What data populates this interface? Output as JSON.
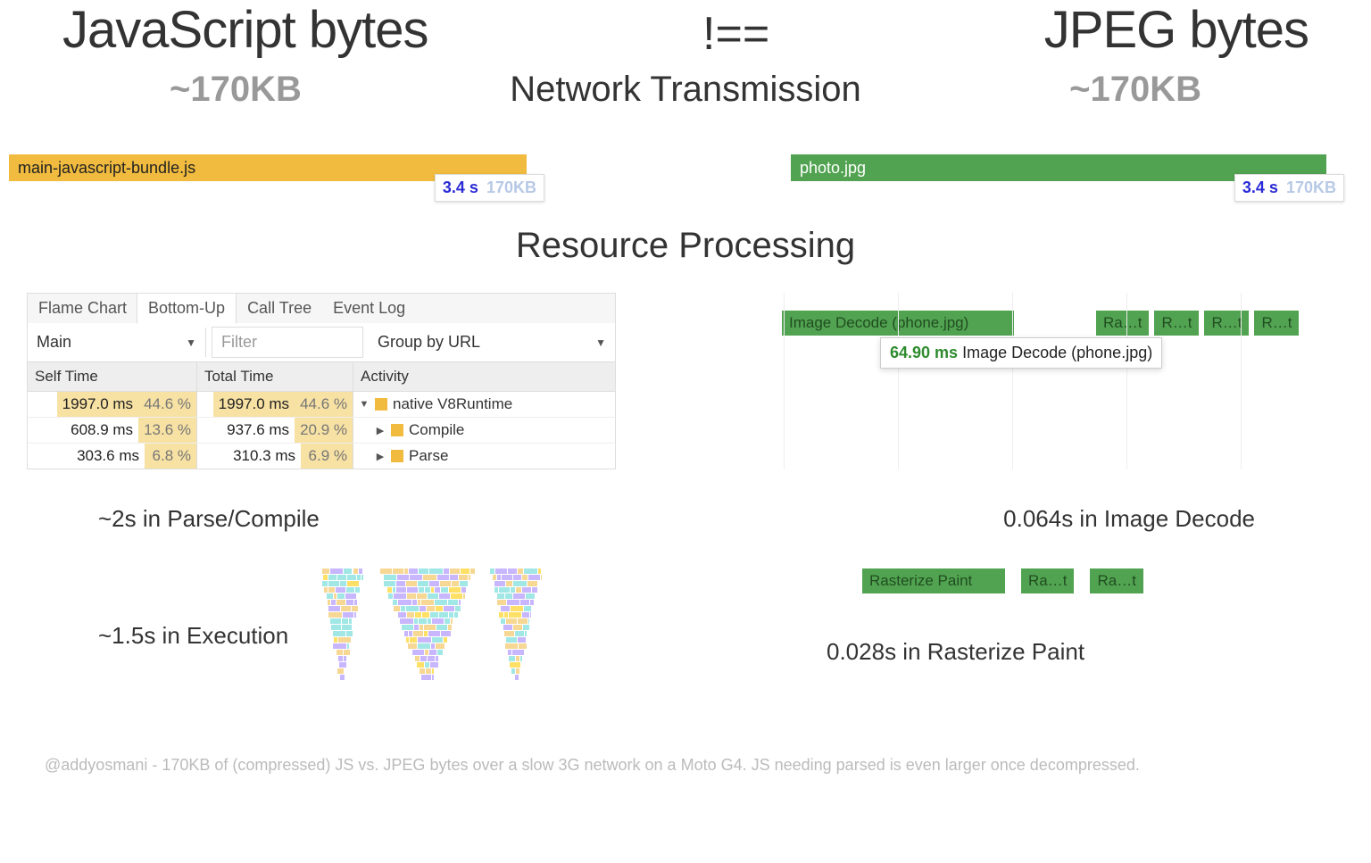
{
  "top": {
    "left": "JavaScript bytes",
    "neq": "!==",
    "right": "JPEG bytes"
  },
  "kb": {
    "left": "~170KB",
    "right": "~170KB",
    "network_title": "Network Transmission"
  },
  "bars": {
    "js_file": "main-javascript-bundle.js",
    "jpg_file": "photo.jpg",
    "time": "3.4 s",
    "size": "170KB"
  },
  "resource_title": "Resource Processing",
  "devtools": {
    "tabs": [
      "Flame Chart",
      "Bottom-Up",
      "Call Tree",
      "Event Log"
    ],
    "active_tab": 1,
    "main_select": "Main",
    "filter_placeholder": "Filter",
    "group_by": "Group by URL",
    "headers": {
      "self": "Self Time",
      "total": "Total Time",
      "activity": "Activity"
    },
    "rows": [
      {
        "self_ms": "1997.0 ms",
        "self_pct": "44.6 %",
        "total_ms": "1997.0 ms",
        "total_pct": "44.6 %",
        "arrow": "▼",
        "activity": "native V8Runtime"
      },
      {
        "self_ms": "608.9 ms",
        "self_pct": "13.6 %",
        "total_ms": "937.6 ms",
        "total_pct": "20.9 %",
        "arrow": "▶",
        "activity": "Compile"
      },
      {
        "self_ms": "303.6 ms",
        "self_pct": "6.8 %",
        "total_ms": "310.3 ms",
        "total_pct": "6.9 %",
        "arrow": "▶",
        "activity": "Parse"
      }
    ]
  },
  "decode": {
    "main": "Image Decode (phone.jpg)",
    "small": "Ra…t",
    "small2": "R…t",
    "tooltip_ms": "64.90 ms",
    "tooltip_label": "Image Decode (phone.jpg)"
  },
  "summary": {
    "parse": "~2s in Parse/Compile",
    "decode": "0.064s in Image Decode",
    "exec": "~1.5s in Execution",
    "raster": "0.028s in Rasterize Paint"
  },
  "raster": {
    "main": "Rasterize Paint",
    "small": "Ra…t"
  },
  "footer": "@addyosmani - 170KB of (compressed) JS vs. JPEG bytes over a slow 3G network on a Moto G4. JS needing parsed is even larger once decompressed."
}
